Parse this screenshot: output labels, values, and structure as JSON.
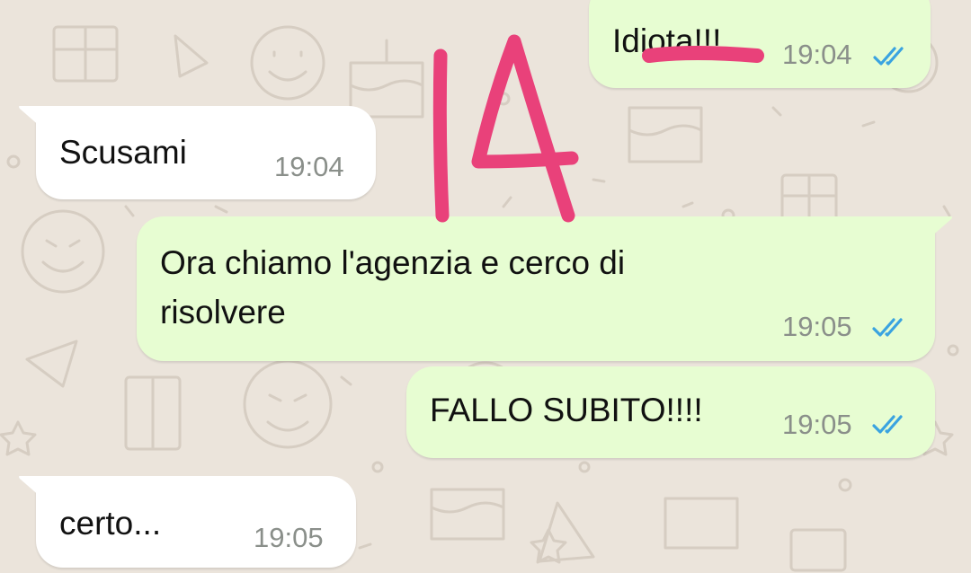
{
  "colors": {
    "background": "#ebe4db",
    "incoming_bubble": "#ffffff",
    "outgoing_bubble": "#e7fdd2",
    "read_check": "#3aa3e0",
    "annotation": "#e9417a"
  },
  "chat": {
    "messages": [
      {
        "direction": "outgoing",
        "text": "Idiota!!!",
        "time": "19:04",
        "status_icon": "double-check-read-icon"
      },
      {
        "direction": "incoming",
        "text": "Scusami",
        "time": "19:04"
      },
      {
        "direction": "outgoing",
        "text": "Ora chiamo l'agenzia e cerco di\nrisolvere",
        "time": "19:05",
        "status_icon": "double-check-read-icon"
      },
      {
        "direction": "outgoing",
        "text": "FALLO SUBITO!!!!",
        "time": "19:05",
        "status_icon": "double-check-read-icon"
      },
      {
        "direction": "incoming",
        "text": "certo...",
        "time": "19:05"
      }
    ]
  },
  "annotation": {
    "text": "14"
  }
}
